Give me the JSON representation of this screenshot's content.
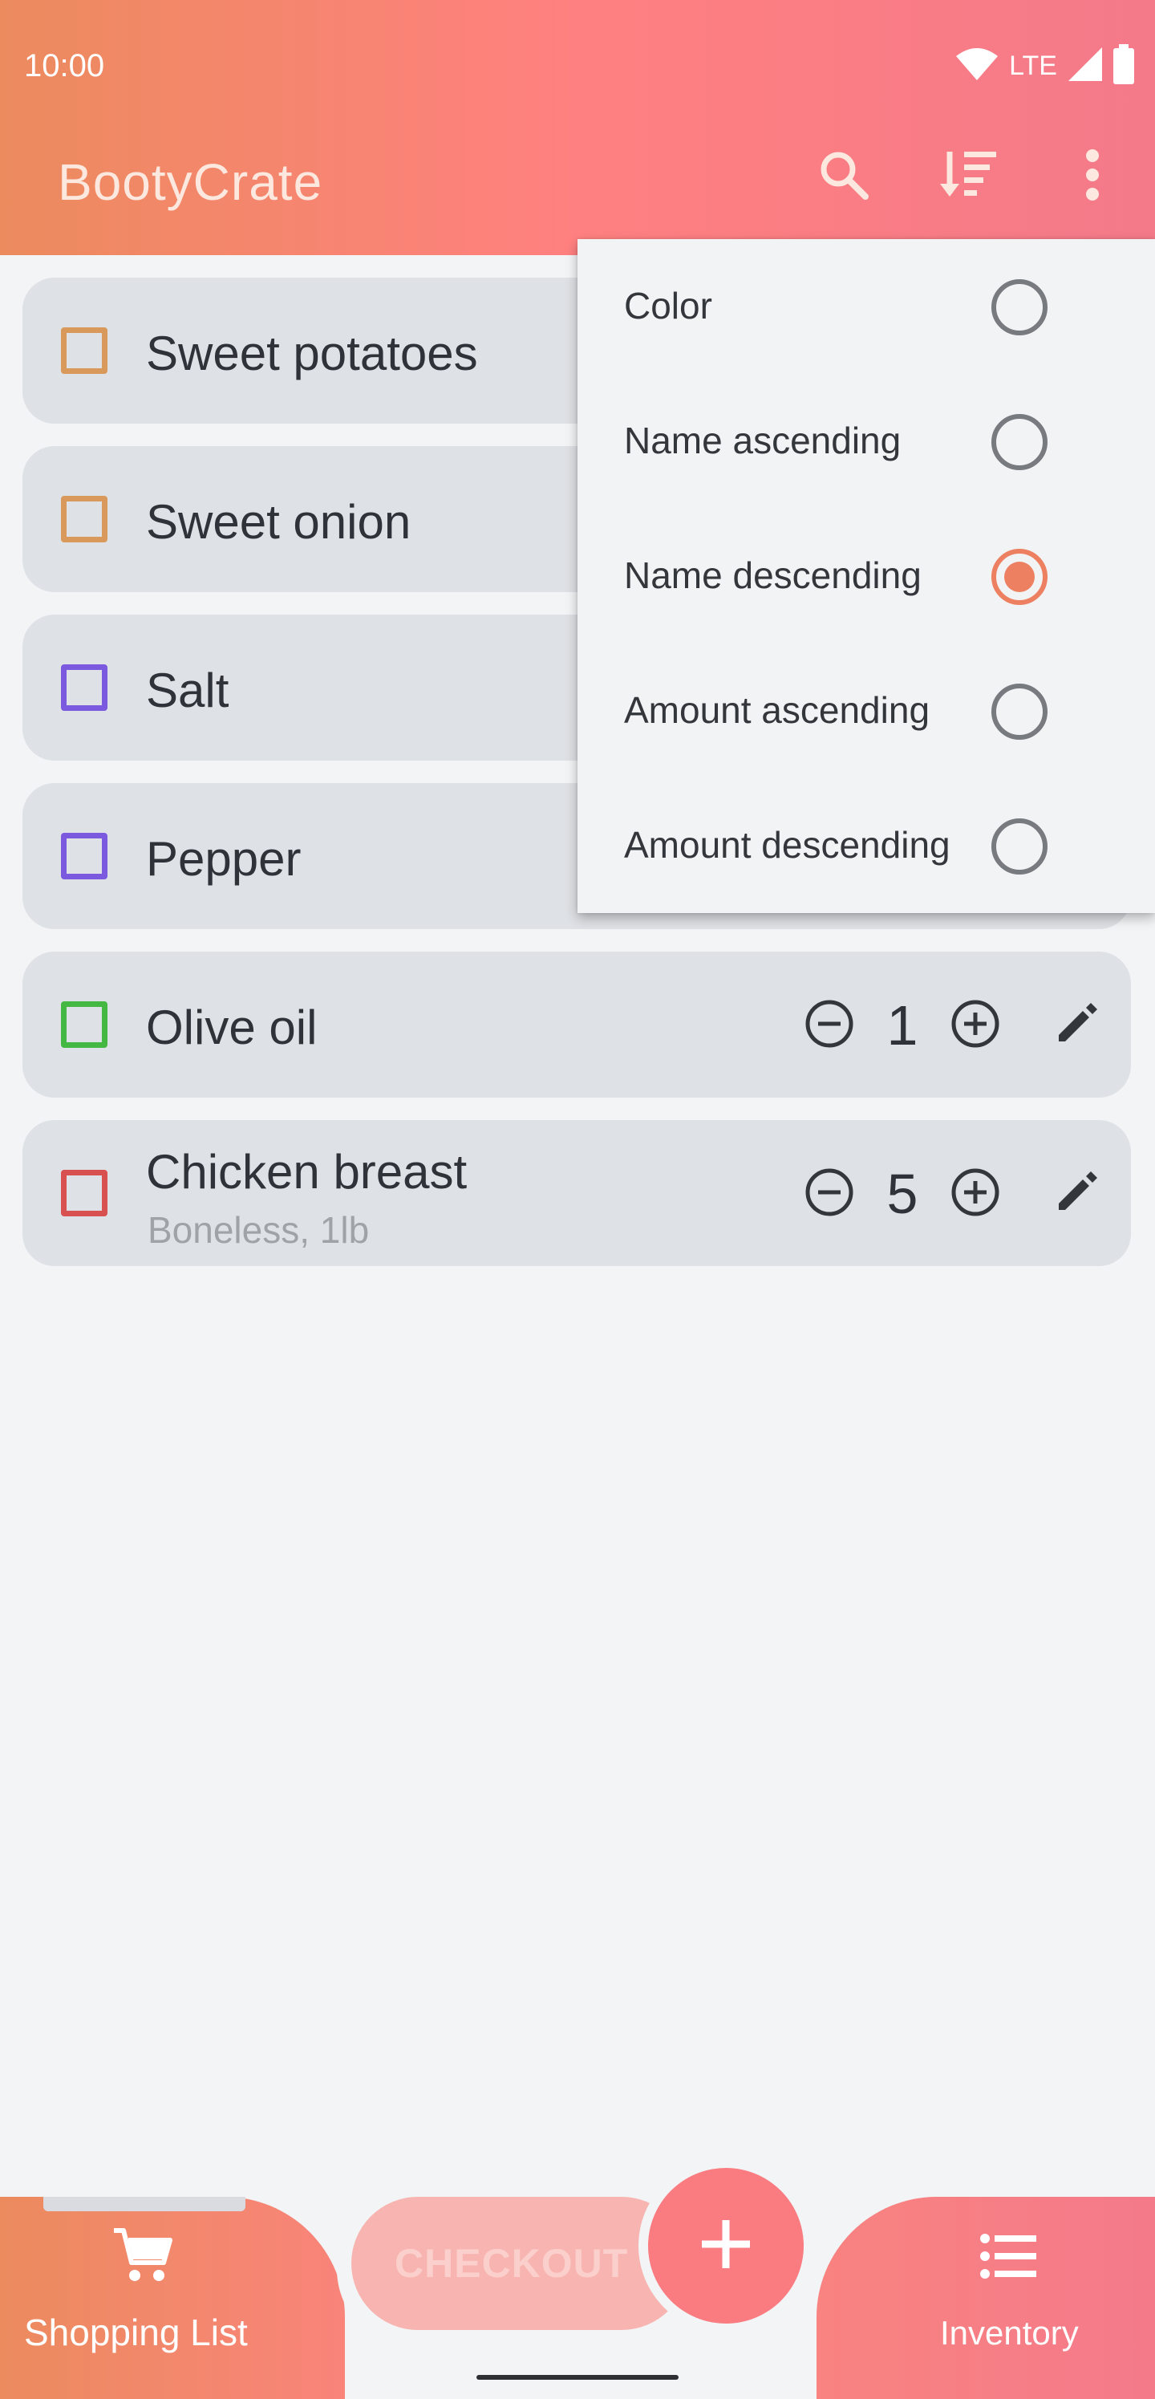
{
  "status_bar": {
    "time": "10:00",
    "network": "LTE",
    "icons": [
      "wifi-icon",
      "signal-icon",
      "battery-icon"
    ]
  },
  "toolbar": {
    "title": "BootyCrate",
    "icons": [
      "search-icon",
      "sort-icon",
      "more-vert-icon"
    ]
  },
  "colors": {
    "accent": "#ec8060",
    "gradient_start": "#ec8b5e",
    "gradient_mid": "#ff8080",
    "gradient_end": "#f47a8a"
  },
  "items": [
    {
      "name": "Sweet potatoes",
      "extra": "",
      "amount": "",
      "color": "#d9995b",
      "checked": false
    },
    {
      "name": "Sweet onion",
      "extra": "",
      "amount": "",
      "color": "#d9995b",
      "checked": false
    },
    {
      "name": "Salt",
      "extra": "",
      "amount": "",
      "color": "#7b5ae0",
      "checked": false
    },
    {
      "name": "Pepper",
      "extra": "",
      "amount": "",
      "color": "#7b5ae0",
      "checked": false
    },
    {
      "name": "Olive oil",
      "extra": "",
      "amount": "1",
      "color": "#44b843",
      "checked": false
    },
    {
      "name": "Chicken breast",
      "extra": "Boneless, 1lb",
      "amount": "5",
      "color": "#d95050",
      "checked": false
    }
  ],
  "sort_menu": {
    "options": [
      {
        "label": "Color",
        "selected": false
      },
      {
        "label": "Name ascending",
        "selected": false
      },
      {
        "label": "Name descending",
        "selected": true
      },
      {
        "label": "Amount ascending",
        "selected": false
      },
      {
        "label": "Amount descending",
        "selected": false
      }
    ]
  },
  "bottom_nav": {
    "shopping_label": "Shopping List",
    "inventory_label": "Inventory",
    "checkout_label": "CHECKOUT",
    "active": "Shopping List"
  }
}
